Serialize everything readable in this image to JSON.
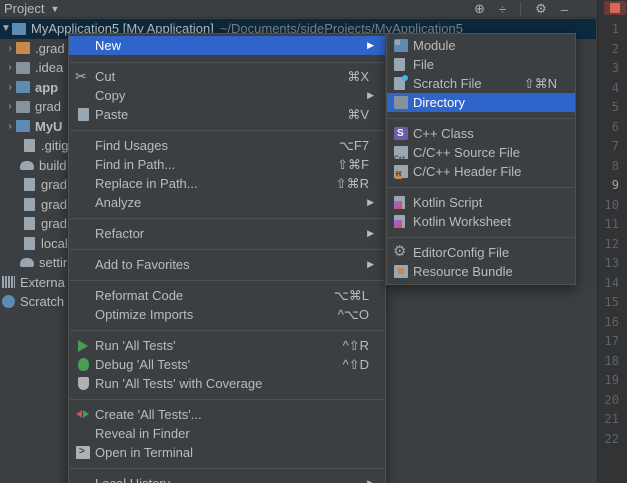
{
  "panel": {
    "title": "Project",
    "tools": {
      "locate": "⊕",
      "collapse": "÷",
      "settings": "⚙",
      "hide": "–"
    }
  },
  "tree": {
    "root": {
      "label": "MyApplication5 [My Application]",
      "path": "~/Documents/sideProjects/MyApplication5"
    },
    "items": [
      {
        "label": ".grad"
      },
      {
        "label": ".idea"
      },
      {
        "label": "app"
      },
      {
        "label": "grad"
      },
      {
        "label": "MyU"
      },
      {
        "label": ".gitig"
      },
      {
        "label": "build"
      },
      {
        "label": "grad"
      },
      {
        "label": "grad"
      },
      {
        "label": "grad"
      },
      {
        "label": "local"
      },
      {
        "label": "settir"
      },
      {
        "label": "Externa"
      },
      {
        "label": "Scratch"
      }
    ]
  },
  "gutter": {
    "lines": [
      "1",
      "2",
      "3",
      "4",
      "5",
      "6",
      "7",
      "8",
      "9",
      "10",
      "11",
      "12",
      "13",
      "14",
      "15",
      "16",
      "17",
      "18",
      "19",
      "20",
      "21",
      "22"
    ],
    "current_line": "9"
  },
  "menu": {
    "new": "New",
    "cut": {
      "label": "Cut",
      "shortcut": "⌘X"
    },
    "copy": "Copy",
    "paste": {
      "label": "Paste",
      "shortcut": "⌘V"
    },
    "find_usages": {
      "label": "Find Usages",
      "shortcut": "⌥F7"
    },
    "find_in_path": {
      "label": "Find in Path...",
      "shortcut": "⇧⌘F"
    },
    "replace_in_path": {
      "label": "Replace in Path...",
      "shortcut": "⇧⌘R"
    },
    "analyze": "Analyze",
    "refactor": "Refactor",
    "add_to_favorites": "Add to Favorites",
    "reformat_code": {
      "label": "Reformat Code",
      "shortcut": "⌥⌘L"
    },
    "optimize_imports": {
      "label": "Optimize Imports",
      "shortcut": "^⌥O"
    },
    "run": {
      "label": "Run 'All Tests'",
      "shortcut": "^⇧R"
    },
    "debug": {
      "label": "Debug 'All Tests'",
      "shortcut": "^⇧D"
    },
    "coverage": "Run 'All Tests' with Coverage",
    "create_tests": "Create 'All Tests'...",
    "reveal": "Reveal in Finder",
    "terminal": "Open in Terminal",
    "local_history": "Local History"
  },
  "submenu": {
    "module": "Module",
    "file": "File",
    "scratch": {
      "label": "Scratch File",
      "shortcut": "⇧⌘N"
    },
    "directory": "Directory",
    "cpp_class": "C++ Class",
    "cpp_source": "C/C++ Source File",
    "cpp_header": "C/C++ Header File",
    "kotlin_script": "Kotlin Script",
    "kotlin_worksheet": "Kotlin Worksheet",
    "editorconfig": "EditorConfig File",
    "resource_bundle": "Resource Bundle"
  },
  "colors": {
    "background": "#3c3f41",
    "selection": "#2f65ca",
    "text": "#bbbbbb"
  }
}
